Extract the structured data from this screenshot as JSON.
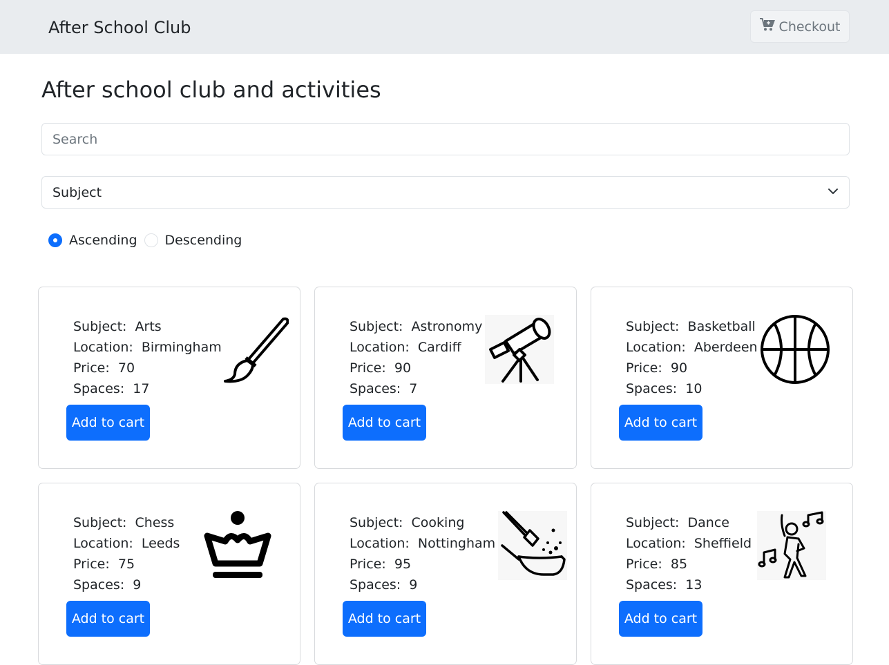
{
  "navbar": {
    "brand": "After School Club",
    "checkout_label": "Checkout",
    "checkout_icon": "cart-plus-icon"
  },
  "main": {
    "title": "After school club and activities",
    "search": {
      "placeholder": "Search",
      "value": ""
    },
    "sort_select": {
      "selected": "Subject"
    },
    "order": {
      "options": [
        "Ascending",
        "Descending"
      ],
      "selected": "Ascending"
    }
  },
  "labels": {
    "subject": "Subject:",
    "location": "Location:",
    "price": "Price:",
    "spaces": "Spaces:",
    "add_to_cart": "Add to cart"
  },
  "lessons": [
    {
      "subject": "Arts",
      "location": "Birmingham",
      "price": "70",
      "spaces": "17",
      "icon": "paintbrush-icon"
    },
    {
      "subject": "Astronomy",
      "location": "Cardiff",
      "price": "90",
      "spaces": "7",
      "icon": "telescope-icon"
    },
    {
      "subject": "Basketball",
      "location": "Aberdeen",
      "price": "90",
      "spaces": "10",
      "icon": "basketball-icon"
    },
    {
      "subject": "Chess",
      "location": "Leeds",
      "price": "75",
      "spaces": "9",
      "icon": "chess-queen-icon"
    },
    {
      "subject": "Cooking",
      "location": "Nottingham",
      "price": "95",
      "spaces": "9",
      "icon": "frying-pan-icon"
    },
    {
      "subject": "Dance",
      "location": "Sheffield",
      "price": "85",
      "spaces": "13",
      "icon": "dancer-icon"
    }
  ],
  "colors": {
    "primary": "#0d6efd",
    "navbar_bg": "#e9ecef"
  }
}
